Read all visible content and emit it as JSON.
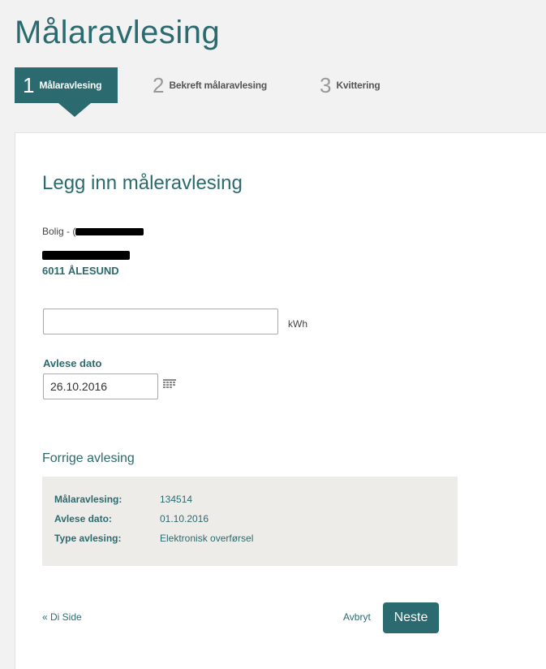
{
  "page": {
    "title": "Målaravlesing"
  },
  "steps": [
    {
      "number": "1",
      "label": "Målaravlesing"
    },
    {
      "number": "2",
      "label": "Bekreft målaravlesing"
    },
    {
      "number": "3",
      "label": "Kvittering"
    }
  ],
  "form": {
    "title": "Legg inn måleravlesing",
    "meter_prefix": "Bolig - (",
    "address_city": "6011 ÅLESUND",
    "reading_value": "",
    "reading_unit": "kWh",
    "date_label": "Avlese dato",
    "date_value": "26.10.2016"
  },
  "previous": {
    "title": "Forrige avlesing",
    "rows": [
      {
        "label": "Målaravlesing:",
        "value": "134514"
      },
      {
        "label": "Avlese dato:",
        "value": "01.10.2016"
      },
      {
        "label": "Type avlesing:",
        "value": "Elektronisk overførsel"
      }
    ]
  },
  "footer": {
    "back_label": "« Di Side",
    "cancel_label": "Avbryt",
    "next_label": "Neste"
  },
  "colors": {
    "accent": "#2b6b70",
    "panel_bg": "#eeece8"
  },
  "icons": {
    "calendar": "calendar-icon"
  }
}
